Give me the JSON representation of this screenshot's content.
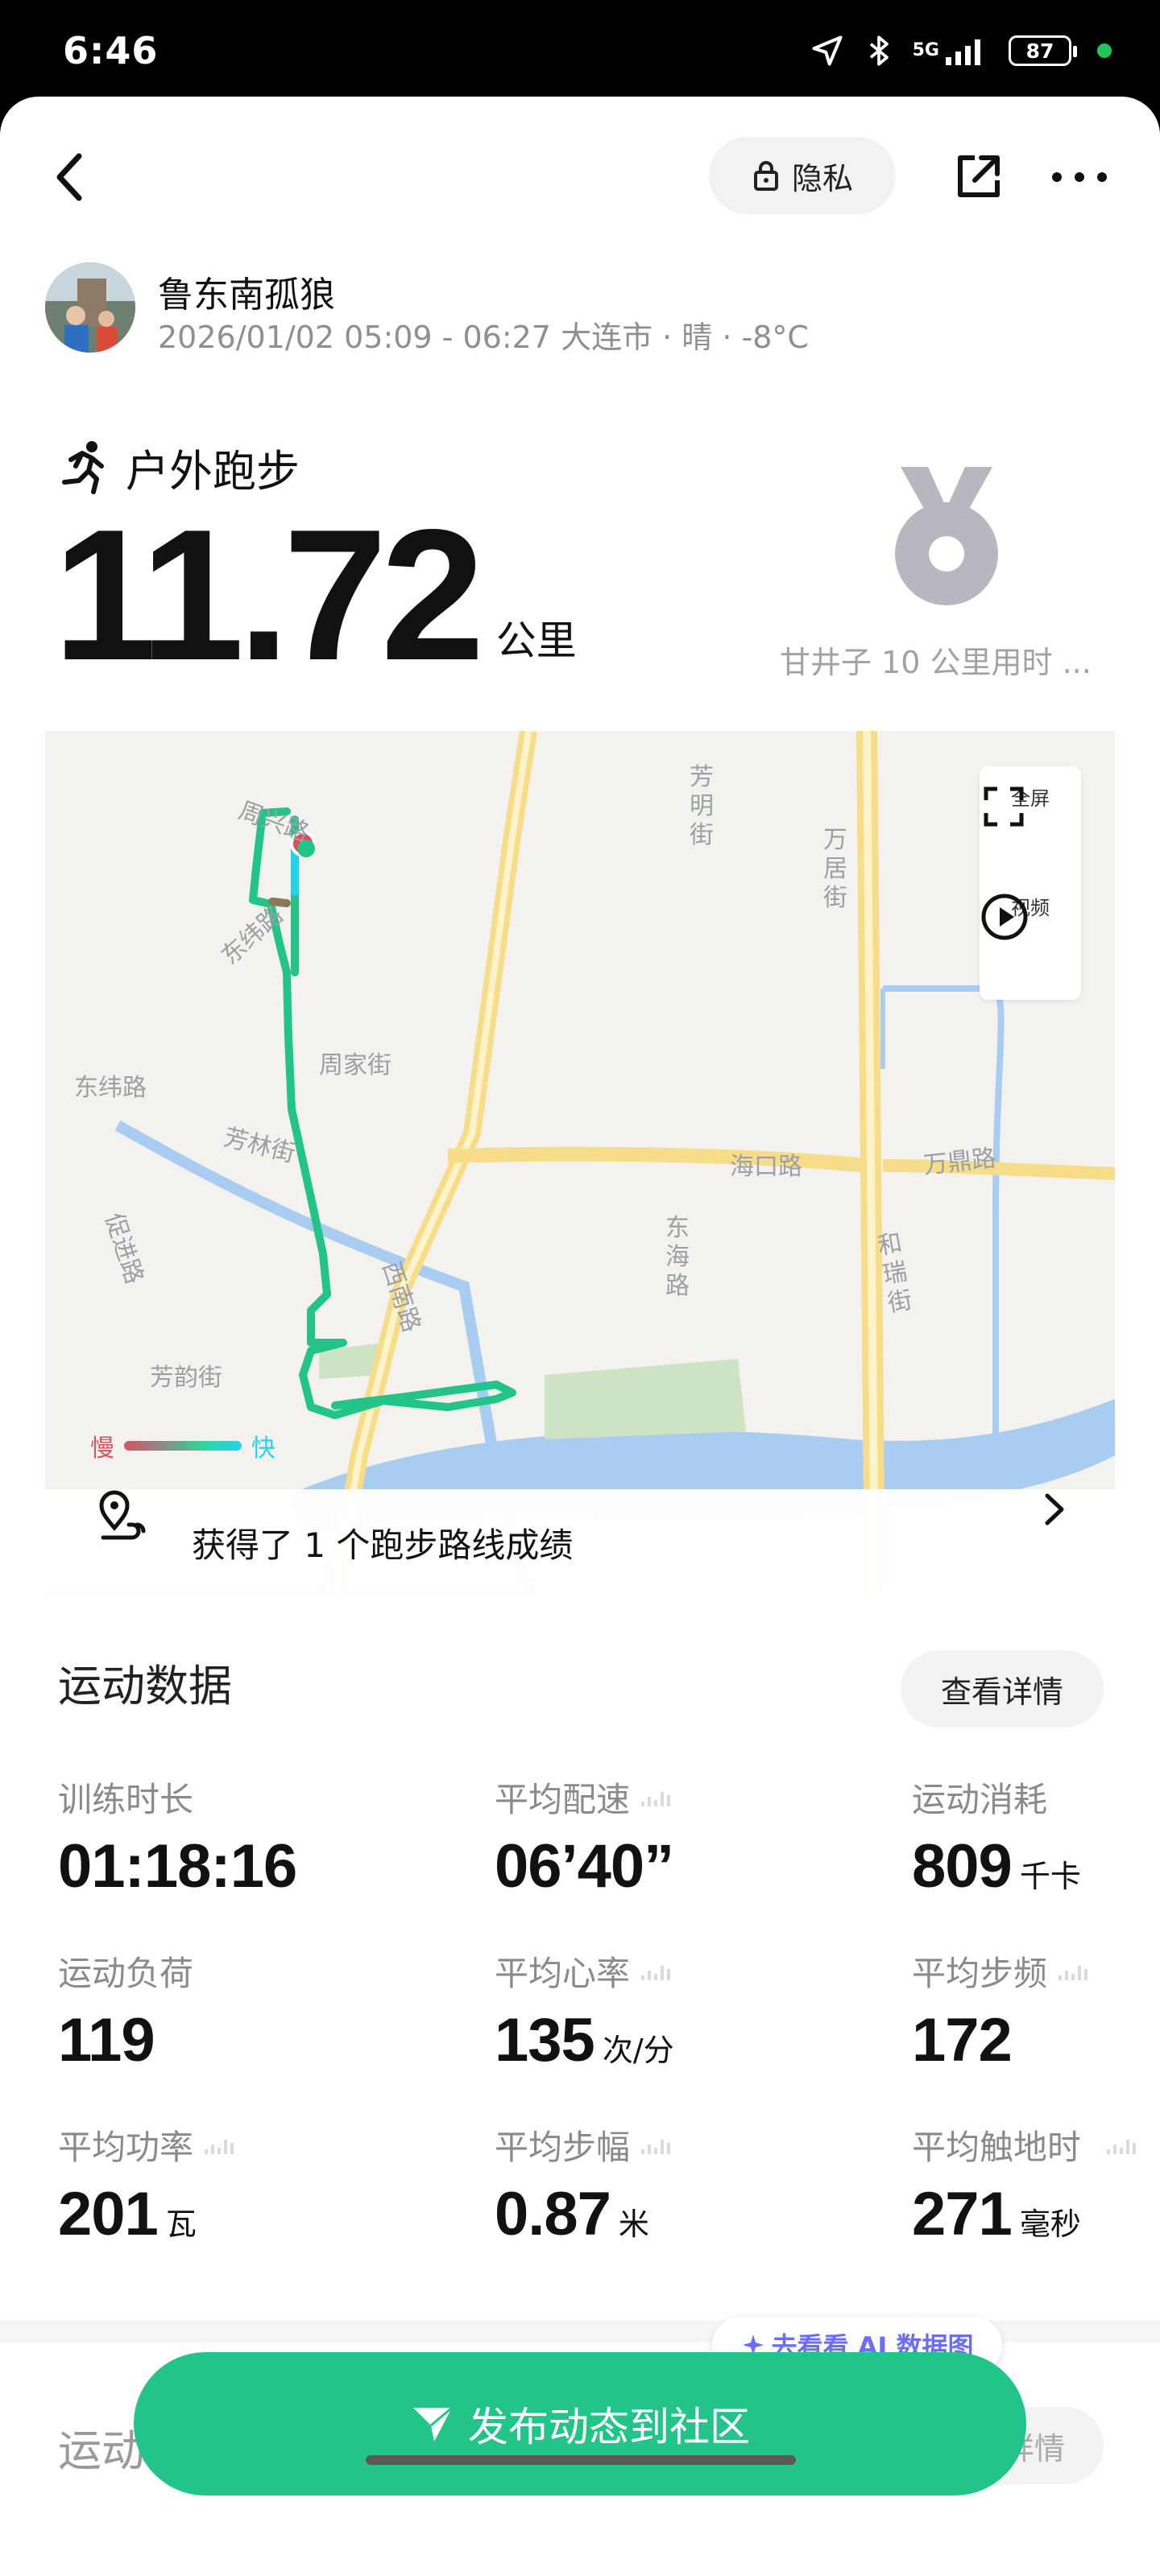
{
  "status_bar": {
    "time": "6:46",
    "network": "5G",
    "battery": "87",
    "icons": [
      "location-icon",
      "bluetooth-icon",
      "signal-icon",
      "battery-icon"
    ]
  },
  "header": {
    "privacy_label": "隐私"
  },
  "user": {
    "name": "鲁东南孤狼",
    "meta": "2026/01/02 05:09 - 06:27 大连市 · 晴 · -8°C"
  },
  "activity": {
    "type": "户外跑步",
    "distance": "11.72",
    "distance_unit": "公里",
    "medal_label": "甘井子 10 公里用时 ..."
  },
  "map": {
    "controls": {
      "fullscreen": "全屏",
      "video": "视频"
    },
    "legend": {
      "slow": "慢",
      "fast": "快"
    },
    "route_achievement": "获得了 1 个跑步路线成绩",
    "street_labels": {
      "zhouxing": "周兴路",
      "dongwei1": "东纬路",
      "dongwei2": "东纬路",
      "zhoujia": "周家街",
      "fanglin": "芳林街",
      "cujin": "促进路",
      "fangyun": "芳韵街",
      "xinan": "西南路",
      "fangming": "芳明街",
      "wanju": "万居街",
      "haikou": "海口路",
      "donghai": "东海路",
      "wanding": "万鼎路",
      "herui": "和瑞街"
    },
    "colors": {
      "route": "#22c48a",
      "route_fast": "#22d3ee",
      "start": "#ef4357",
      "road": "#f7dc8a",
      "water": "#a9cdf0"
    }
  },
  "stats": {
    "title": "运动数据",
    "detail_button": "查看详情",
    "items": [
      {
        "label": "训练时长",
        "value": "01:18:16",
        "unit": ""
      },
      {
        "label": "平均配速",
        "value": "06’40”",
        "unit": ""
      },
      {
        "label": "运动消耗",
        "value": "809",
        "unit": "千卡"
      },
      {
        "label": "运动负荷",
        "value": "119",
        "unit": ""
      },
      {
        "label": "平均心率",
        "value": "135",
        "unit": "次/分"
      },
      {
        "label": "平均步频",
        "value": "172",
        "unit": ""
      },
      {
        "label": "平均功率",
        "value": "201",
        "unit": "瓦"
      },
      {
        "label": "平均步幅",
        "value": "0.87",
        "unit": "米"
      },
      {
        "label": "平均触地时",
        "value": "271",
        "unit": "毫秒"
      }
    ]
  },
  "section2": {
    "title": "运动",
    "detail_button": "详情"
  },
  "floating": {
    "ai_chip": "去看看 AI 数据图",
    "publish_button": "发布动态到社区"
  }
}
